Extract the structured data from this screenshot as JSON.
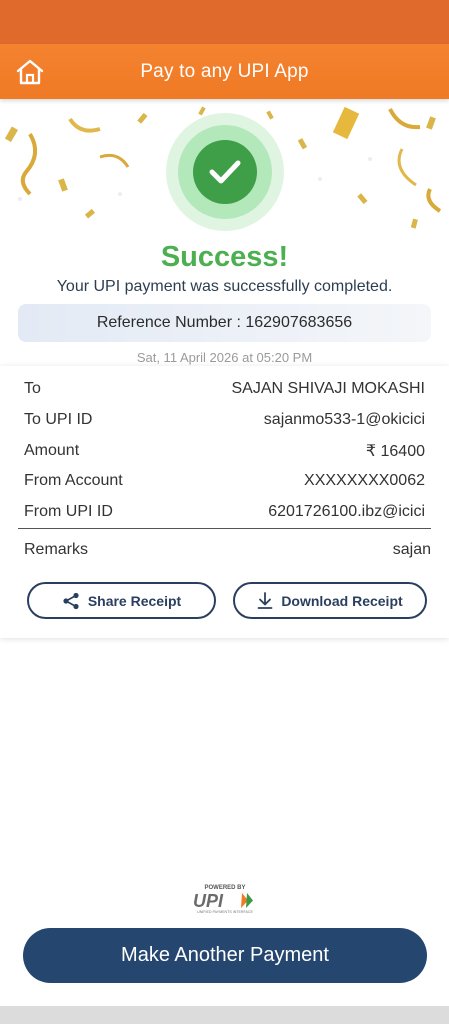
{
  "header": {
    "title": "Pay to any UPI App",
    "home_icon": "home-icon"
  },
  "status": {
    "title": "Success!",
    "subtitle": "Your UPI payment was successfully completed.",
    "reference": "Reference Number : 162907683656",
    "datetime": "Sat, 11 April 2026 at 05:20 PM"
  },
  "details": [
    {
      "label": "To",
      "value": "SAJAN SHIVAJI MOKASHI"
    },
    {
      "label": "To UPI ID",
      "value": "sajanmo533-1@okicici"
    },
    {
      "label": "Amount",
      "value": "₹ 16400"
    },
    {
      "label": "From Account",
      "value": "XXXXXXXX0062"
    },
    {
      "label": "From UPI ID",
      "value": "6201726100.ibz@icici"
    },
    {
      "label": "Remarks",
      "value": "sajan"
    }
  ],
  "actions": {
    "share": "Share Receipt",
    "download": "Download Receipt"
  },
  "footer": {
    "powered_by": "POWERED BY",
    "brand": "UPI",
    "brand_sub": "UNIFIED PAYMENTS INTERFACE",
    "main_button": "Make Another Payment"
  },
  "colors": {
    "accent": "#f07a25",
    "success": "#4caf50",
    "primary": "#25476f"
  }
}
